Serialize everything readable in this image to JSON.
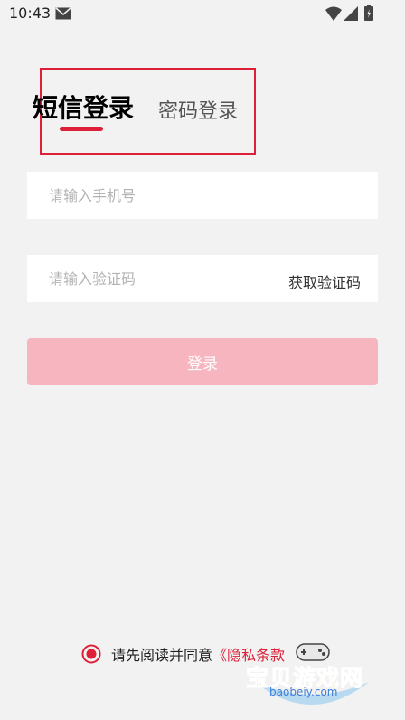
{
  "status_bar": {
    "time": "10:43",
    "icons": [
      "mail-icon",
      "wifi-icon",
      "signal-icon",
      "battery-icon"
    ]
  },
  "tabs": {
    "sms_label": "短信登录",
    "password_label": "密码登录",
    "active": "sms",
    "accent_color": "#dd1f38"
  },
  "form": {
    "phone_placeholder": "请输入手机号",
    "phone_value": "",
    "code_placeholder": "请输入验证码",
    "code_value": "",
    "get_code_label": "获取验证码"
  },
  "login_button": {
    "label": "登录",
    "color": "#f7b6bf"
  },
  "agreement": {
    "text": "请先阅读并同意",
    "link_text": "《隐私条款",
    "checked": true
  },
  "watermark": {
    "title": "宝贝游戏网",
    "url": "baobeiy.com"
  }
}
